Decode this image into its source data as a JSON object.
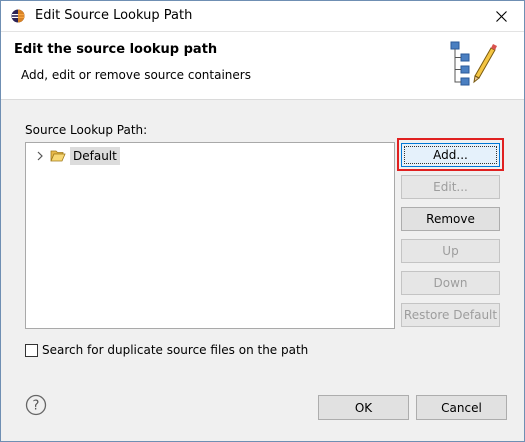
{
  "window": {
    "title": "Edit Source Lookup Path"
  },
  "banner": {
    "title": "Edit the source lookup path",
    "subtitle": "Add, edit or remove source containers"
  },
  "lookup": {
    "label": "Source Lookup Path:",
    "items": [
      {
        "label": "Default",
        "expanded": false
      }
    ]
  },
  "buttons": {
    "add": "Add...",
    "edit": "Edit...",
    "remove": "Remove",
    "up": "Up",
    "down": "Down",
    "restore": "Restore Default"
  },
  "options": {
    "search_duplicates_label": "Search for duplicate source files on the path",
    "search_duplicates_checked": false
  },
  "footer": {
    "ok": "OK",
    "cancel": "Cancel"
  },
  "colors": {
    "highlight": "#e02020",
    "accent": "#0078d7"
  }
}
